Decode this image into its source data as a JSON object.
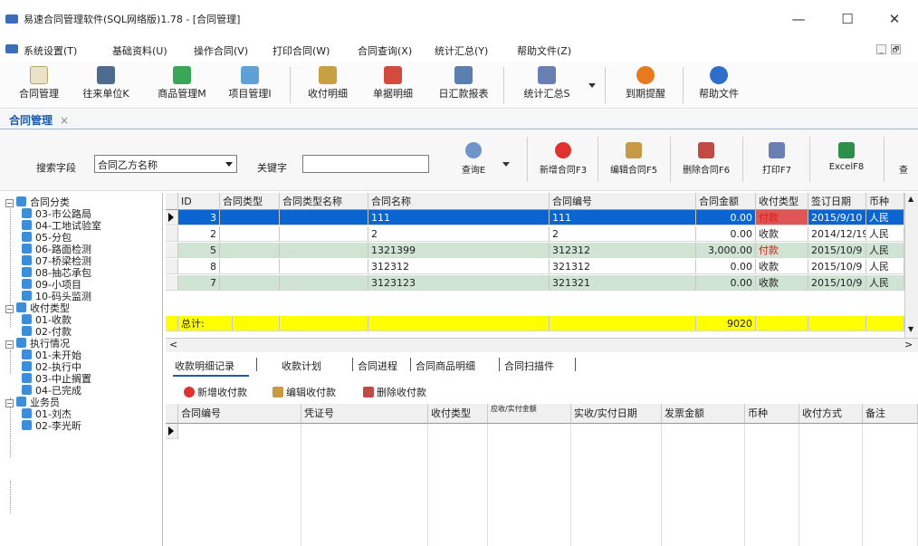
{
  "window": {
    "title": "易速合同管理软件(SQL网络版)1.78 - [合同管理]",
    "minimize": "—",
    "maximize": "☐",
    "close": "✕"
  },
  "menu": {
    "items": [
      "系统设置(T)",
      "基础资料(U)",
      "操作合同(V)",
      "打印合同(W)",
      "合同查询(X)",
      "统计汇总(Y)",
      "帮助文件(Z)"
    ],
    "mdi_min": "_",
    "mdi_restore": "🗗"
  },
  "toolbar": {
    "buttons": [
      "合同管理",
      "往来单位K",
      "商品管理M",
      "项目管理I",
      "收付明细",
      "单据明细",
      "日汇款报表",
      "统计汇总S",
      "到期提醒",
      "帮助文件"
    ]
  },
  "doc_tab": {
    "label": "合同管理",
    "close": "×"
  },
  "search": {
    "field_label": "搜索字段",
    "field_value": "合同乙方名称",
    "keyword_label": "关键字",
    "keyword_value": "",
    "buttons": [
      "查询E",
      "新增合同F3",
      "编辑合同F5",
      "删除合同F6",
      "打印F7",
      "ExcelF8",
      "查"
    ]
  },
  "tree": {
    "nodes": [
      {
        "label": "合同分类",
        "level": 0,
        "exp": "−"
      },
      {
        "label": "03-市公路局",
        "level": 1
      },
      {
        "label": "04-工地试验室",
        "level": 1
      },
      {
        "label": "05-分包",
        "level": 1
      },
      {
        "label": "06-路面检测",
        "level": 1
      },
      {
        "label": "07-桥梁检测",
        "level": 1
      },
      {
        "label": "08-抽芯承包",
        "level": 1
      },
      {
        "label": "09-小项目",
        "level": 1
      },
      {
        "label": "10-码头监测",
        "level": 1
      },
      {
        "label": "收付类型",
        "level": 0,
        "exp": "−"
      },
      {
        "label": "01-收款",
        "level": 1
      },
      {
        "label": "02-付款",
        "level": 1
      },
      {
        "label": "执行情况",
        "level": 0,
        "exp": "−"
      },
      {
        "label": "01-未开始",
        "level": 1
      },
      {
        "label": "02-执行中",
        "level": 1
      },
      {
        "label": "03-中止搁置",
        "level": 1
      },
      {
        "label": "04-已完成",
        "level": 1
      },
      {
        "label": "业务员",
        "level": 0,
        "exp": "−"
      },
      {
        "label": "01-刘杰",
        "level": 1
      },
      {
        "label": "02-李光昕",
        "level": 1
      }
    ]
  },
  "grid": {
    "columns": [
      "ID",
      "合同类型",
      "合同类型名称",
      "合同名称",
      "合同编号",
      "合同金额",
      "收付类型",
      "签订日期",
      "币种"
    ],
    "rows": [
      [
        "3",
        "",
        "",
        "111",
        "111",
        "0.00",
        "付款",
        "2015/9/10",
        "人民"
      ],
      [
        "2",
        "",
        "",
        "2",
        "2",
        "0.00",
        "收款",
        "2014/12/19",
        "人民"
      ],
      [
        "5",
        "",
        "",
        "1321399",
        "312312",
        "3,000.00",
        "付款",
        "2015/10/9",
        "人民"
      ],
      [
        "8",
        "",
        "",
        "312312",
        "321312",
        "0.00",
        "收款",
        "2015/10/9",
        "人民"
      ],
      [
        "7",
        "",
        "",
        "3123123",
        "321321",
        "0.00",
        "收款",
        "2015/10/9",
        "人民"
      ]
    ],
    "total_label": "总计:",
    "total_amount": "9020"
  },
  "scroll": {
    "left": "<",
    "right": ">",
    "up": "▲",
    "down": "▼"
  },
  "subtabs": [
    "收款明细记录",
    "收款计划",
    "合同进程",
    "合同商品明细",
    "合同扫描件"
  ],
  "actions": [
    "新增收付款",
    "编辑收付款",
    "删除收付款"
  ],
  "grid2": {
    "columns": [
      "合同编号",
      "凭证号",
      "收付类型",
      "应收/实付金额",
      "实收/实付日期",
      "发票金额",
      "币种",
      "收付方式",
      "备注"
    ]
  },
  "colors": {
    "selected_row": "#0a64d2",
    "alt_row": "#cfe4d2",
    "total_row": "#ffff00",
    "red_text": "#d61c1c"
  }
}
